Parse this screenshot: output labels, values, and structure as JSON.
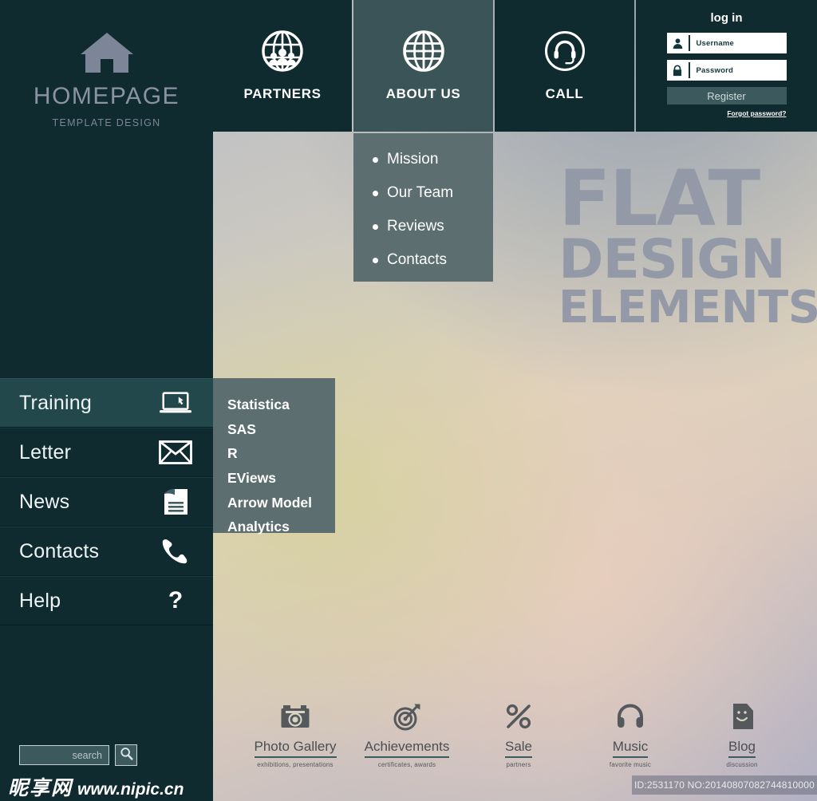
{
  "brand": {
    "icon": "home-icon",
    "title": "HOMEPAGE",
    "subtitle": "TEMPLATE DESIGN"
  },
  "topnav": {
    "items": [
      {
        "label": "PARTNERS",
        "icon": "globe-people-icon",
        "active": false
      },
      {
        "label": "ABOUT US",
        "icon": "globe-icon",
        "active": true
      },
      {
        "label": "CALL",
        "icon": "headset-icon",
        "active": false
      }
    ]
  },
  "dropdown": {
    "parent": "ABOUT US",
    "items": [
      "Mission",
      "Our Team",
      "Reviews",
      "Contacts"
    ]
  },
  "login": {
    "title": "log in",
    "username_placeholder": "Username",
    "username_value": "",
    "username_icon": "user-icon",
    "password_placeholder": "Password",
    "password_value": "",
    "password_icon": "lock-icon",
    "register_label": "Register",
    "forgot_label": "Forgot  password?"
  },
  "sidebar": {
    "items": [
      {
        "label": "Training",
        "icon": "laptop-icon",
        "active": true
      },
      {
        "label": "Letter",
        "icon": "envelope-icon",
        "active": false
      },
      {
        "label": "News",
        "icon": "newspaper-icon",
        "active": false
      },
      {
        "label": "Contacts",
        "icon": "phone-icon",
        "active": false
      },
      {
        "label": "Help",
        "icon": "question-mark-icon",
        "active": false
      }
    ]
  },
  "submenu": {
    "items": [
      "Statistica",
      "SAS",
      "R",
      "EViews",
      "Arrow Model",
      "Analytics"
    ]
  },
  "hero": {
    "line1": "FLAT",
    "line2": "DESIGN",
    "line3": "ELEMENTS"
  },
  "search": {
    "placeholder": "search",
    "value": "",
    "button_icon": "magnifier-icon"
  },
  "footer_links": [
    {
      "title": "Photo Gallery",
      "subtitle": "exhibitions, presentations",
      "icon": "camera-icon"
    },
    {
      "title": "Achievements",
      "subtitle": "certificates, awards",
      "icon": "target-icon"
    },
    {
      "title": "Sale",
      "subtitle": "partners",
      "icon": "percent-icon"
    },
    {
      "title": "Music",
      "subtitle": "favorite music",
      "icon": "headphones-icon"
    },
    {
      "title": "Blog",
      "subtitle": "discussion",
      "icon": "speech-note-icon"
    }
  ],
  "watermark": {
    "site_cn": "昵享网",
    "site_url": "www.nipic.cn",
    "id_text": "ID:2531170 NO:20140807082744810000"
  },
  "colors": {
    "dark_teal": "#0f2b30",
    "active_teal": "#22484c",
    "panel_gray": "#5c6e70",
    "nav_active": "#3b5457",
    "hero_text": "#9499a8",
    "logo_text": "#8b93a3"
  }
}
